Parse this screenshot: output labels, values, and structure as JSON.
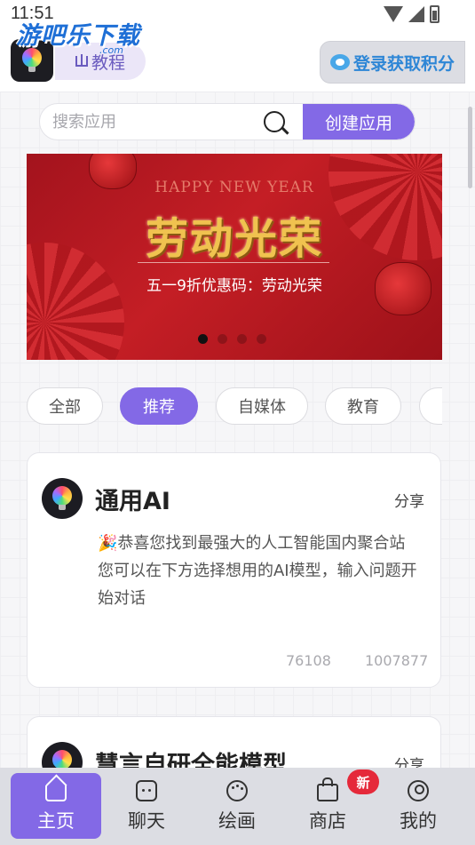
{
  "status_bar": {
    "time": "11:51"
  },
  "header": {
    "watermark": "游吧乐下载",
    "watermark_url": ".com",
    "tutorial_label": "教程",
    "login_label": "登录获取积分"
  },
  "search": {
    "placeholder": "搜索应用",
    "create_label": "创建应用"
  },
  "banner": {
    "english": "HAPPY NEW YEAR",
    "title": "劳动光荣",
    "subtitle": "五一9折优惠码：劳动光荣",
    "dots": 4,
    "active_dot": 1
  },
  "categories": [
    {
      "label": "全部",
      "active": false
    },
    {
      "label": "推荐",
      "active": true
    },
    {
      "label": "自媒体",
      "active": false
    },
    {
      "label": "教育",
      "active": false
    },
    {
      "label": "",
      "active": false
    }
  ],
  "cards": [
    {
      "title": "通用AI",
      "share": "分享",
      "description": "🎉恭喜您找到最强大的人工智能国内聚合站 您可以在下方选择想用的AI模型，输入问题开始对话",
      "stat1": "76108",
      "stat2": "1007877"
    },
    {
      "title": "慧言自研全能模型",
      "share": "分享"
    }
  ],
  "bottom_nav": [
    {
      "label": "主页",
      "icon": "home-icon",
      "active": true
    },
    {
      "label": "聊天",
      "icon": "chat-icon",
      "active": false
    },
    {
      "label": "绘画",
      "icon": "palette-icon",
      "active": false
    },
    {
      "label": "商店",
      "icon": "bag-icon",
      "active": false
    },
    {
      "label": "我的",
      "icon": "user-icon",
      "active": false
    }
  ],
  "new_badge": "新",
  "colors": {
    "accent": "#8369e6",
    "banner_red": "#c41e25",
    "gold": "#f0c24f",
    "badge_red": "#e5293a"
  }
}
